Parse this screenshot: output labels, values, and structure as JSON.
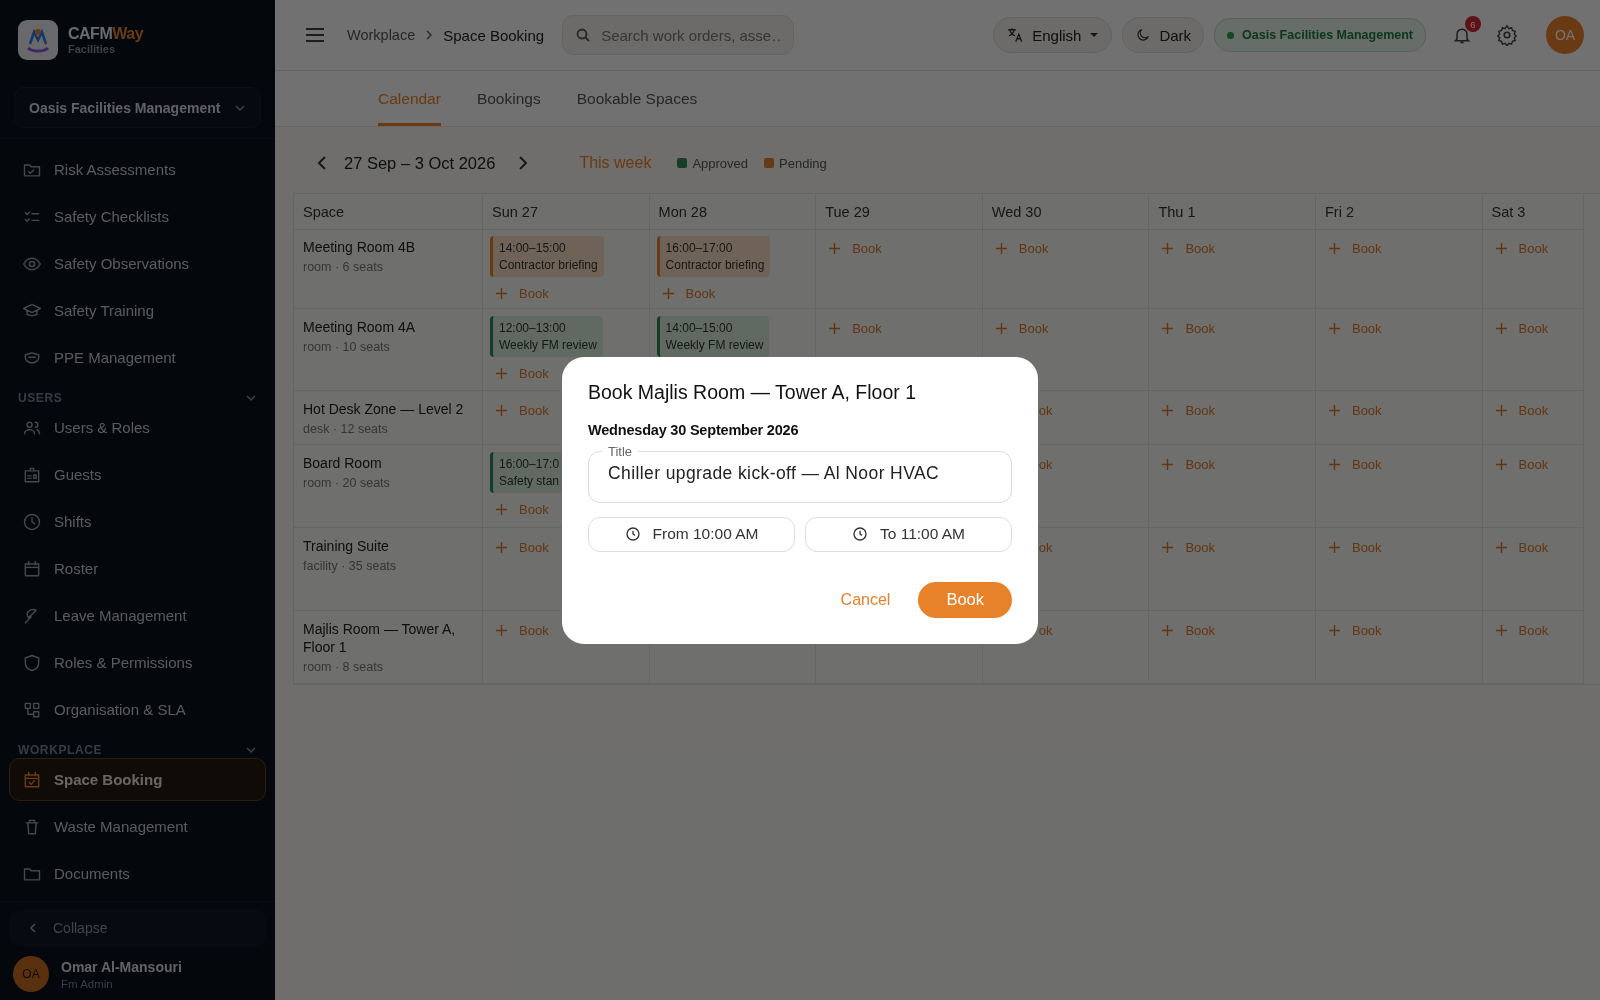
{
  "sidebar": {
    "brand": {
      "primary": "CAFM",
      "accent": "Way",
      "subtitle": "Facilities"
    },
    "org_select": "Oasis Facilities Management",
    "groups": [
      {
        "items": [
          {
            "label": "Risk Assessments",
            "selected": false
          },
          {
            "label": "Safety Checklists",
            "selected": false
          },
          {
            "label": "Safety Observations",
            "selected": false
          },
          {
            "label": "Safety Training",
            "selected": false
          },
          {
            "label": "PPE Management",
            "selected": false
          }
        ]
      },
      {
        "header": "USERS",
        "expanded": true,
        "items": [
          {
            "label": "Users & Roles",
            "selected": false
          },
          {
            "label": "Guests",
            "selected": false
          },
          {
            "label": "Shifts",
            "selected": false
          },
          {
            "label": "Roster",
            "selected": false
          },
          {
            "label": "Leave Management",
            "selected": false
          },
          {
            "label": "Roles & Permissions",
            "selected": false
          },
          {
            "label": "Organisation & SLA",
            "selected": false
          }
        ]
      },
      {
        "header": "WORKPLACE",
        "expanded": true,
        "items": [
          {
            "label": "Space Booking",
            "selected": true
          },
          {
            "label": "Waste Management",
            "selected": false
          },
          {
            "label": "Documents",
            "selected": false
          }
        ]
      }
    ],
    "collapse": "Collapse",
    "user": {
      "initials": "OA",
      "name": "Omar Al-Mansouri",
      "role": "Fm Admin"
    }
  },
  "topbar": {
    "breadcrumb": [
      "Workplace",
      "Space Booking"
    ],
    "search": {
      "placeholder": "Search work orders, asse…"
    },
    "language": "English",
    "theme": "Dark",
    "org_chip": "Oasis Facilities Management",
    "notifications": "6",
    "avatar": "OA"
  },
  "tabs": [
    {
      "label": "Calendar",
      "selected": true
    },
    {
      "label": "Bookings",
      "selected": false
    },
    {
      "label": "Bookable Spaces",
      "selected": false
    }
  ],
  "week": {
    "range": "27 Sep – 3 Oct 2026",
    "today": "This week",
    "legend": [
      {
        "label": "Approved",
        "color": "#153f24"
      },
      {
        "label": "Pending",
        "color": "#683a13"
      }
    ]
  },
  "calendar": {
    "space_header": "Space",
    "day_headers": [
      "Sun 27",
      "Mon 28",
      "Tue 29",
      "Wed 30",
      "Thu 1",
      "Fri 2",
      "Sat 3"
    ],
    "spaces": [
      {
        "name": "Meeting Room 4B",
        "meta": "room · 6 seats",
        "days": {
          "sun": {
            "events": [
              {
                "time": "14:00–15:00",
                "title": "Contractor briefing",
                "kind": "pending"
              }
            ],
            "book": "Book"
          },
          "mon": {
            "events": [
              {
                "time": "16:00–17:00",
                "title": "Contractor briefing",
                "kind": "pending"
              }
            ],
            "book": "Book"
          },
          "tue": {
            "book": "Book"
          },
          "wed": {
            "book": "Book"
          },
          "thu": {
            "book": "Book"
          },
          "fri": {
            "book": "Book"
          },
          "sat": {
            "book": "Book"
          }
        }
      },
      {
        "name": "Meeting Room 4A",
        "meta": "room · 10 seats",
        "days": {
          "sun": {
            "events": [
              {
                "time": "12:00–13:00",
                "title": "Weekly FM review",
                "kind": "approved"
              }
            ],
            "book": "Book"
          },
          "mon": {
            "events": [
              {
                "time": "14:00–15:00",
                "title": "Weekly FM review",
                "kind": "approved"
              }
            ]
          },
          "tue": {
            "book": "Book"
          },
          "wed": {
            "book": "Book"
          },
          "thu": {
            "book": "Book"
          },
          "fri": {
            "book": "Book"
          },
          "sat": {
            "book": "Book"
          }
        }
      },
      {
        "name": "Hot Desk Zone — Level 2",
        "meta": "desk · 12 seats",
        "days": {
          "sun": {
            "book": "Book"
          },
          "wed": {
            "clipped": "ok"
          },
          "thu": {
            "book": "Book"
          },
          "fri": {
            "book": "Book"
          },
          "sat": {
            "book": "Book"
          }
        }
      },
      {
        "name": "Board Room",
        "meta": "room · 20 seats",
        "days": {
          "sun": {
            "events": [
              {
                "time": "16:00–17:0",
                "title": "Safety stan",
                "kind": "approved"
              }
            ],
            "book": "Book"
          },
          "wed": {
            "clipped": "ok"
          },
          "thu": {
            "book": "Book"
          },
          "fri": {
            "book": "Book"
          },
          "sat": {
            "book": "Book"
          }
        }
      },
      {
        "name": "Training Suite",
        "meta": "facility · 35 seats",
        "days": {
          "sun": {
            "book": "Book"
          },
          "wed": {
            "clipped": "ok"
          },
          "thu": {
            "book": "Book"
          },
          "fri": {
            "book": "Book"
          },
          "sat": {
            "book": "Book"
          }
        }
      },
      {
        "name": "Majlis Room — Tower A, Floor 1",
        "meta": "room · 8 seats",
        "days": {
          "sun": {
            "book": "Book"
          },
          "wed": {
            "clipped": "ok"
          },
          "thu": {
            "book": "Book"
          },
          "fri": {
            "book": "Book"
          },
          "sat": {
            "book": "Book"
          }
        }
      }
    ]
  },
  "modal": {
    "title": "Book Majlis Room — Tower A, Floor 1",
    "date": "Wednesday 30 September 2026",
    "field": {
      "label": "Title",
      "value": "Chiller upgrade kick-off — Al Noor HVAC"
    },
    "from": "From 10:00 AM",
    "to": "To 11:00 AM",
    "cancel": "Cancel",
    "confirm": "Book"
  }
}
